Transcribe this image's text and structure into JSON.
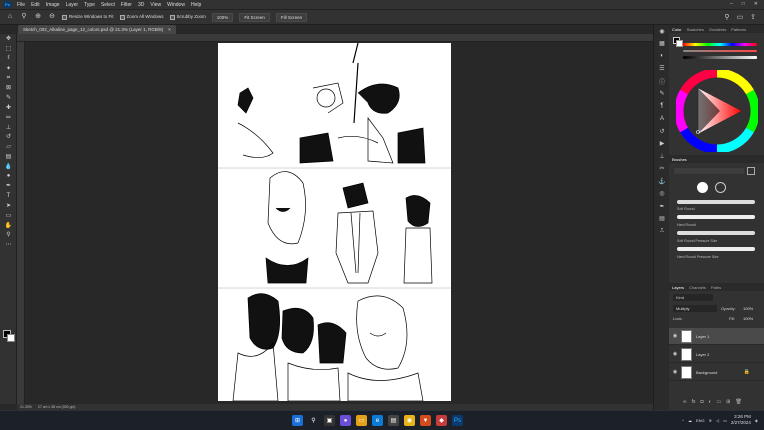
{
  "menu": {
    "logo": "Ps",
    "items": [
      "File",
      "Edit",
      "Image",
      "Layer",
      "Type",
      "Select",
      "Filter",
      "3D",
      "View",
      "Window",
      "Help"
    ]
  },
  "options": {
    "resize_windows": "Resize Windows to Fit",
    "zoom_all": "Zoom All Windows",
    "scrubby": "Scrubby Zoom",
    "pct": "100%",
    "fit": "Fit Screen",
    "fill": "Fill Screen"
  },
  "document": {
    "tab_title": "Sketch_002_Alkaline_page_12_colors.psd @ 21.3% (Layer 1, RGB/8)",
    "close": "×"
  },
  "status": {
    "zoom": "21.33%",
    "doc_size": "27 cm x 38 cm (300 ppi)"
  },
  "panels": {
    "color_tabs": [
      "Color",
      "Swatches",
      "Gradients",
      "Patterns"
    ],
    "brushes_title": "Brushes",
    "brushes": [
      "Soft Round",
      "Hard Round",
      "Soft Round Pressure Size",
      "Hard Round Pressure Size"
    ],
    "layers_tabs": [
      "Layers",
      "Channels",
      "Paths"
    ],
    "kind": "Kind",
    "blend_mode": "Multiply",
    "opacity_label": "Opacity:",
    "opacity": "100%",
    "lock_label": "Lock:",
    "fill_label": "Fill:",
    "fill": "100%",
    "layers": [
      "Layer 1",
      "Layer 2",
      "Background"
    ]
  },
  "taskbar": {
    "time": "3:26 PM",
    "date": "2/27/2024",
    "lang": "ENG"
  }
}
